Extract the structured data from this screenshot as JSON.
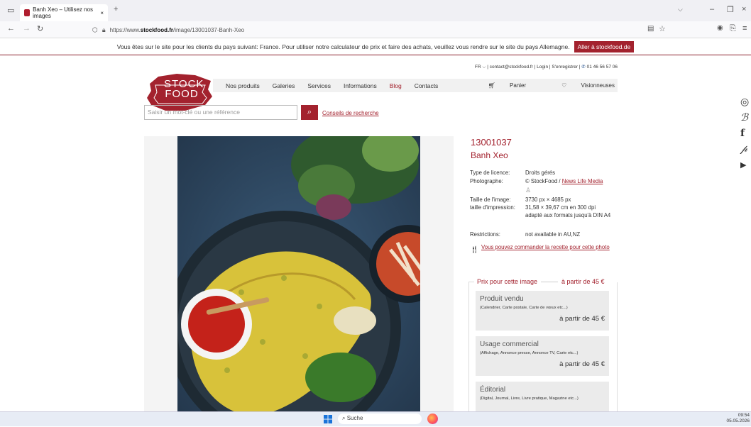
{
  "browser": {
    "tab_title": "Banh Xeo – Utilisez nos images",
    "url_prefix": "https://www.",
    "url_domain": "stockfood.fr",
    "url_path": "/image/13001037-Banh-Xeo"
  },
  "banner": {
    "text": "Vous êtes sur le site pour les clients du pays suivant: France. Pour utiliser notre calculateur de prix et faire des achats, veuillez vous rendre sur le site du pays Allemagne.",
    "button": "Aller à stockfood.de"
  },
  "header": {
    "lang": "FR",
    "email": "contact@stockfood.fr",
    "login": "Login",
    "register": "S'enregistrer",
    "phone": "01 46 56 57 06",
    "logo_line1": "STOCK",
    "logo_line2": "FOOD"
  },
  "nav": {
    "items": [
      "Nos produits",
      "Galeries",
      "Services",
      "Informations",
      "Blog",
      "Contacts"
    ],
    "cart": "Panier",
    "viewer": "Visionneuses"
  },
  "search": {
    "placeholder": "Saisir un mot-clé ou une référence",
    "tips": "Conseils de recherche"
  },
  "image": {
    "id": "13001037",
    "title": "Banh Xeo",
    "details": [
      {
        "k": "Type de licence:",
        "v": "Droits gérés"
      },
      {
        "k": "Photographe:",
        "v": "© StockFood / ",
        "link": "News Life Media"
      },
      {
        "k": "Taille de l'image:",
        "v": "3730 px × 4685 px"
      },
      {
        "k": "taille d'impression:",
        "v": "31,58 × 39,67 cm en 300 dpi adapté aux formats jusqu'à DIN A4"
      },
      {
        "k": "Restrictions:",
        "v": "not available in AU,NZ"
      }
    ],
    "recipe": "Vous pouvez commander la recette pour cette photo"
  },
  "pricing": {
    "head": "Prix pour cette image",
    "head_price": "à partir de 45 €",
    "cards": [
      {
        "title": "Produit vendu",
        "sub": "(Calendrier, Carte postale, Carte de vœux etc...)",
        "price": "à partir de 45 €"
      },
      {
        "title": "Usage commercial",
        "sub": "(Affichage, Annonce presse, Annonce TV, Carte etc...)",
        "price": "à partir de 45 €"
      },
      {
        "title": "Éditorial",
        "sub": "(Digital, Journal, Livre, Livre pratique, Magazine etc...)",
        "price": ""
      }
    ]
  },
  "taskbar": {
    "search": "Suche",
    "time": "09:54",
    "date": "05.05.2026"
  }
}
